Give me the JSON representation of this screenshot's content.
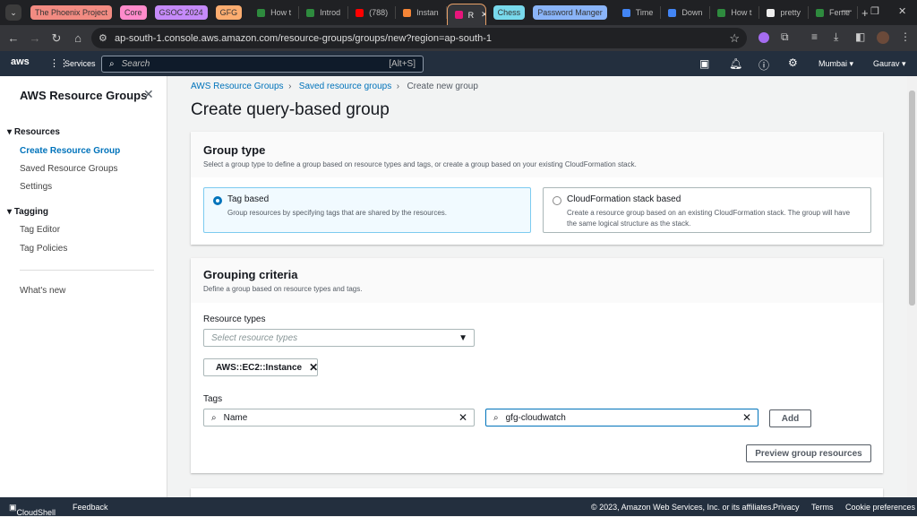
{
  "browser": {
    "tab_groups": [
      {
        "label": "The Phoenix Project",
        "color": "#f28b82"
      },
      {
        "label": "Core",
        "color": "#ff8bcb"
      },
      {
        "label": "GSOC 2024",
        "color": "#c58af9"
      },
      {
        "label": "GFG",
        "color": "#fcad70"
      }
    ],
    "tabs_left": [
      {
        "label": "How t",
        "icon": "#2e8b3e"
      },
      {
        "label": "Introd",
        "icon": "#2e8b3e"
      },
      {
        "label": "(788)",
        "icon": "#ff0000"
      },
      {
        "label": "Instan",
        "icon": "#f58536"
      }
    ],
    "active_tab": {
      "label": "R",
      "icon": "#e7157b"
    },
    "tab_groups_right": [
      {
        "label": "Chess",
        "color": "#78d9ec"
      },
      {
        "label": "Password Manger",
        "color": "#8ab4f8"
      }
    ],
    "tabs_right": [
      {
        "label": "Time",
        "icon": "#4285f4"
      },
      {
        "label": "Down",
        "icon": "#4285f4"
      },
      {
        "label": "How t",
        "icon": "#2e8b3e"
      },
      {
        "label": "pretty",
        "icon": "#eeeeee"
      },
      {
        "label": "Feme",
        "icon": "#2e8b3e"
      }
    ],
    "url": "ap-south-1.console.aws.amazon.com/resource-groups/groups/new?region=ap-south-1"
  },
  "aws": {
    "services": "Services",
    "search_placeholder": "Search",
    "search_shortcut": "[Alt+S]",
    "region": "Mumbai",
    "user": "Gaurav"
  },
  "sidebar": {
    "title": "AWS Resource Groups",
    "sections": [
      {
        "label": "Resources",
        "items": [
          "Create Resource Group",
          "Saved Resource Groups",
          "Settings"
        ]
      },
      {
        "label": "Tagging",
        "items": [
          "Tag Editor",
          "Tag Policies"
        ]
      }
    ],
    "whats_new": "What's new"
  },
  "breadcrumb": [
    "AWS Resource Groups",
    "Saved resource groups",
    "Create new group"
  ],
  "page_title": "Create query-based group",
  "group_type": {
    "title": "Group type",
    "description": "Select a group type to define a group based on resource types and tags, or create a group based on your existing CloudFormation stack.",
    "options": [
      {
        "label": "Tag based",
        "description": "Group resources by specifying tags that are shared by the resources.",
        "selected": true
      },
      {
        "label": "CloudFormation stack based",
        "description": "Create a resource group based on an existing CloudFormation stack. The group will have the same logical structure as the stack.",
        "selected": false
      }
    ]
  },
  "grouping": {
    "title": "Grouping criteria",
    "description": "Define a group based on resource types and tags.",
    "resource_types_label": "Resource types",
    "resource_types_placeholder": "Select resource types",
    "selected_type": "AWS::EC2::Instance",
    "tags_label": "Tags",
    "tag_key": "Name",
    "tag_value": "gfg-cloudwatch",
    "add": "Add",
    "preview": "Preview group resources"
  },
  "footer": {
    "cloudshell": "CloudShell",
    "feedback": "Feedback",
    "copyright": "© 2023, Amazon Web Services, Inc. or its affiliates.",
    "privacy": "Privacy",
    "terms": "Terms",
    "cookies": "Cookie preferences"
  }
}
